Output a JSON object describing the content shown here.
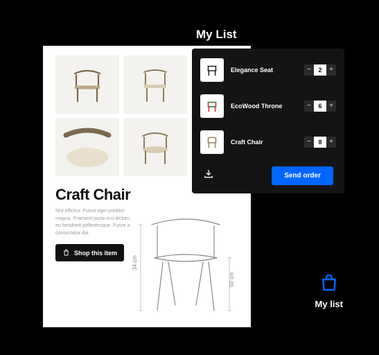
{
  "product": {
    "title": "Craft Chair",
    "description": "Nisl efficitur. Fusce eget porttitor magna. Praesent porta orci dictum, eu hendrerit pellentesque. Fusce a consectetur dui.",
    "shop_label": "Shop this item",
    "diagram": {
      "height_cm": "34 cm",
      "depth_cm": "50 cm"
    }
  },
  "list": {
    "title": "My List",
    "items": [
      {
        "name": "Elegance Seat",
        "qty": "2"
      },
      {
        "name": "EcoWood Throne",
        "qty": "6"
      },
      {
        "name": "Craft Chair",
        "qty": "8"
      }
    ],
    "send_label": "Send order"
  },
  "launcher": {
    "label": "My list"
  },
  "colors": {
    "accent": "#0066ff"
  }
}
